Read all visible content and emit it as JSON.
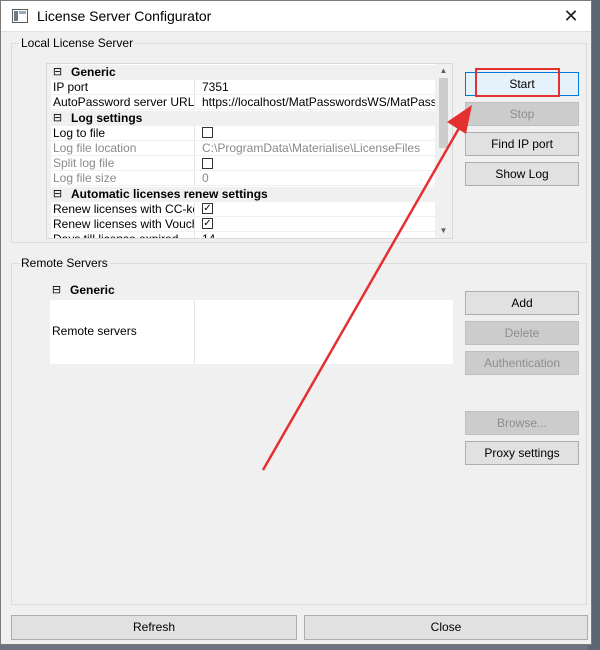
{
  "window": {
    "title": "License Server Configurator",
    "close_glyph": "✕"
  },
  "local": {
    "label": "Local License Server",
    "rows": [
      {
        "kind": "cat",
        "label": "Generic"
      },
      {
        "kind": "prop",
        "name": "IP port",
        "value": "7351",
        "gray": false
      },
      {
        "kind": "prop",
        "name": "AutoPassword server URL",
        "value": "https://localhost/MatPasswordsWS/MatPassword",
        "gray": false
      },
      {
        "kind": "cat",
        "label": "Log settings"
      },
      {
        "kind": "prop",
        "name": "Log to file",
        "checkbox": false,
        "gray": false
      },
      {
        "kind": "prop",
        "name": "Log file location",
        "value": "C:\\ProgramData\\Materialise\\LicenseFiles",
        "gray": true
      },
      {
        "kind": "prop",
        "name": "Split log file",
        "checkbox": false,
        "gray": true
      },
      {
        "kind": "prop",
        "name": "Log file size",
        "value": "0",
        "gray": true
      },
      {
        "kind": "cat",
        "label": "Automatic licenses renew settings"
      },
      {
        "kind": "prop",
        "name": "Renew licenses with CC-key",
        "checkbox": true,
        "gray": false
      },
      {
        "kind": "prop",
        "name": "Renew licenses with Vouch...",
        "checkbox": true,
        "gray": false
      },
      {
        "kind": "prop",
        "name": "Days till license expired",
        "value": "14",
        "gray": false
      }
    ],
    "buttons": {
      "start": "Start",
      "stop": "Stop",
      "find_ip_port": "Find IP port",
      "show_log": "Show Log"
    }
  },
  "remote": {
    "label": "Remote Servers",
    "category": "Generic",
    "remote_servers_label": "Remote servers",
    "buttons": {
      "add": "Add",
      "delete": "Delete",
      "authentication": "Authentication",
      "browse": "Browse...",
      "proxy_settings": "Proxy settings"
    }
  },
  "footer": {
    "refresh": "Refresh",
    "close": "Close"
  },
  "colors": {
    "annotation_red": "#e53030",
    "focus_blue": "#0078d7"
  },
  "icons": {
    "collapse": "⊟",
    "check": "✓",
    "scroll_up": "▲",
    "scroll_down": "▼"
  }
}
